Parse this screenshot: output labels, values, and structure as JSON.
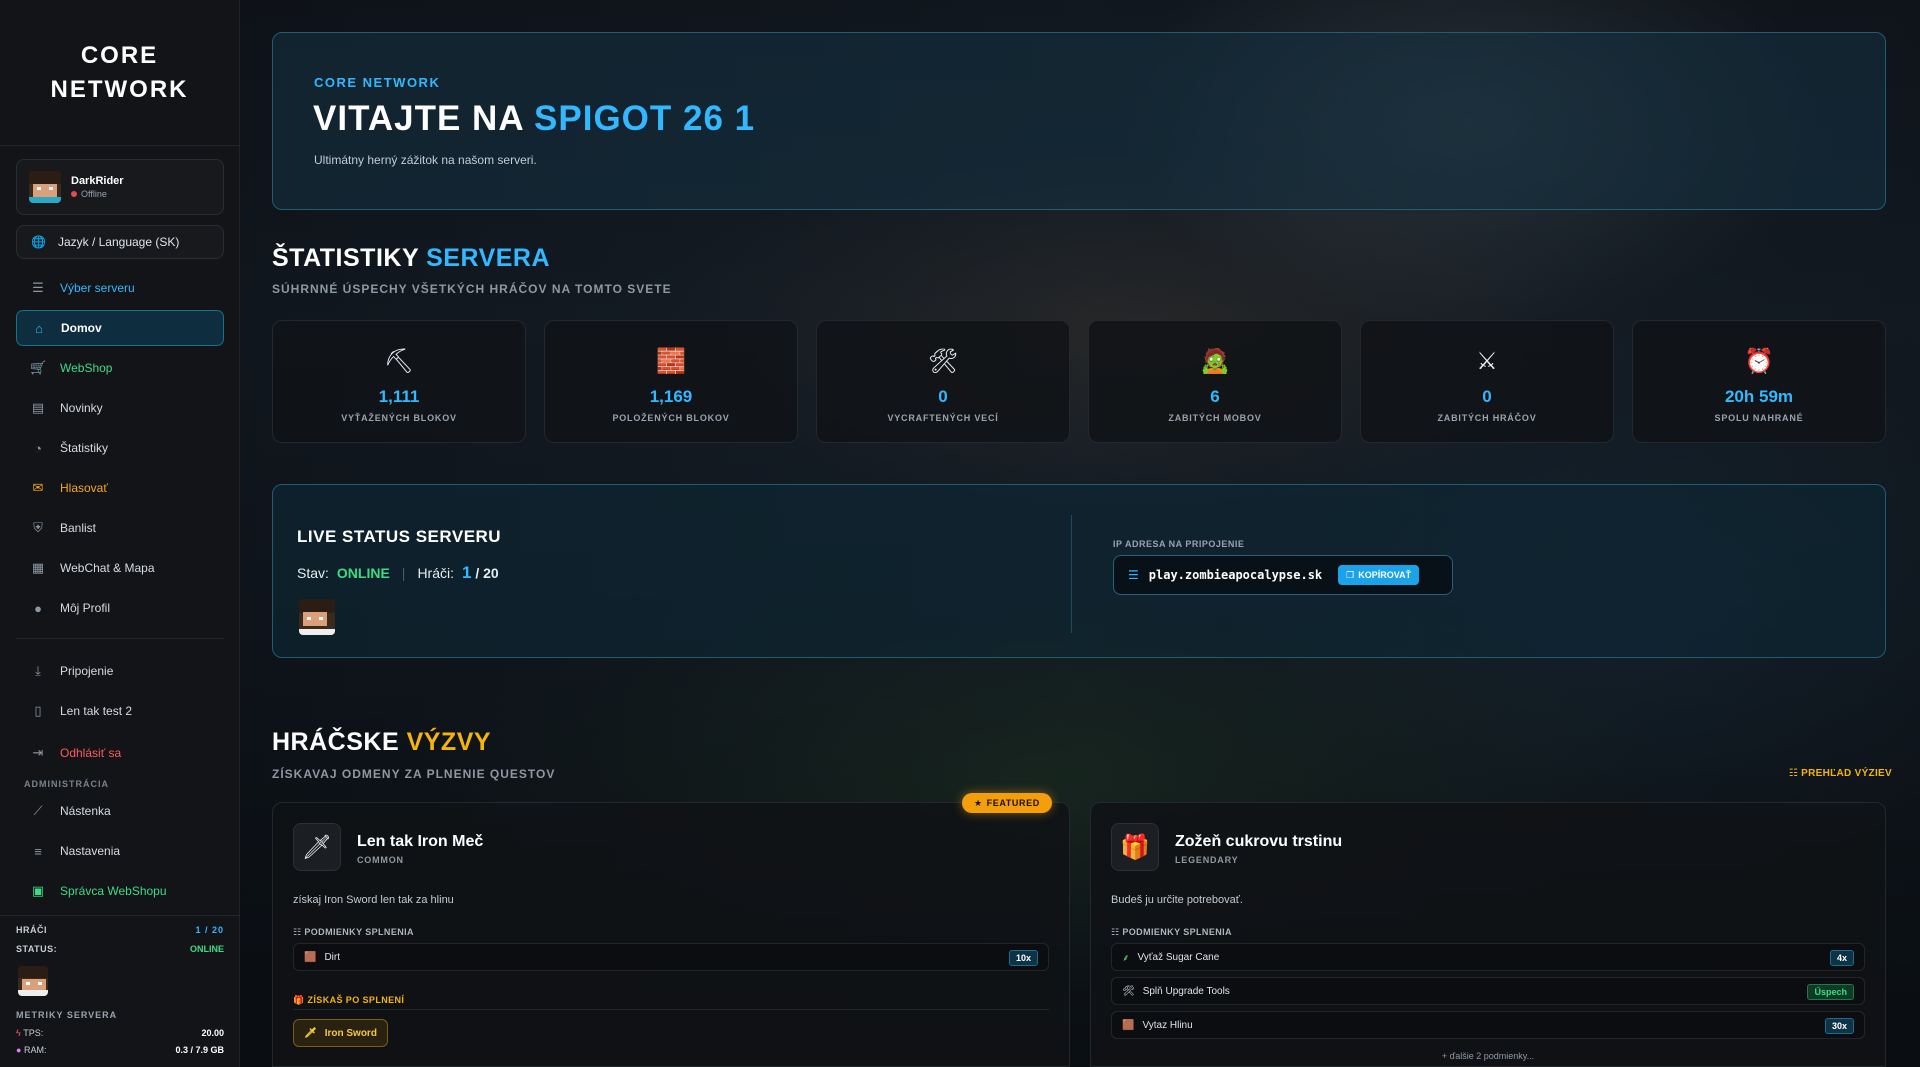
{
  "brand": {
    "line1": "CORE",
    "line2": "NETWORK"
  },
  "user": {
    "name": "DarkRider",
    "status": "Offline"
  },
  "language_button": "Jazyk / Language (SK)",
  "nav": {
    "server_select": "Výber serveru",
    "home": "Domov",
    "webshop": "WebShop",
    "news": "Novinky",
    "stats": "Štatistiky",
    "vote": "Hlasovať",
    "banlist": "Banlist",
    "webchat": "WebChat & Mapa",
    "profile": "Môj Profil",
    "connect": "Pripojenie",
    "test": "Len tak test 2",
    "logout": "Odhlásiť sa",
    "admin_section": "ADMINISTRÁCIA",
    "dashboard": "Nástenka",
    "settings": "Nastavenia",
    "shop_admin": "Správca WebShopu"
  },
  "sidebar_footer": {
    "players_label": "HRÁČI",
    "players_value": "1 / 20",
    "status_label": "STATUS:",
    "status_value": "ONLINE",
    "metrics_title": "METRIKY SERVERA",
    "tps_label": "TPS:",
    "tps_value": "20.00",
    "ram_label": "RAM:",
    "ram_value": "0.3 / 7.9 GB"
  },
  "hero": {
    "kicker": "CORE NETWORK",
    "title_prefix": "VITAJTE NA ",
    "title_accent": "SPIGOT 26 1",
    "subtitle": "Ultimátny herný zážitok na našom serveri."
  },
  "stats_section": {
    "title_prefix": "ŠTATISTIKY ",
    "title_accent": "SERVERA",
    "subtitle": "SÚHRNNÉ ÚSPECHY VŠETKÝCH HRÁČOV NA TOMTO SVETE",
    "items": [
      {
        "icon": "⛏",
        "value": "1,111",
        "label": "VYŤAŽENÝCH BLOKOV"
      },
      {
        "icon": "🧱",
        "value": "1,169",
        "label": "POLOŽENÝCH BLOKOV"
      },
      {
        "icon": "🛠",
        "value": "0",
        "label": "VYCRAFTENÝCH VECÍ"
      },
      {
        "icon": "🧟",
        "value": "6",
        "label": "ZABITÝCH MOBOV"
      },
      {
        "icon": "⚔",
        "value": "0",
        "label": "ZABITÝCH HRÁČOV"
      },
      {
        "icon": "⏰",
        "value": "20h 59m",
        "label": "SPOLU NAHRANÉ"
      }
    ]
  },
  "live": {
    "title": "LIVE STATUS SERVERU",
    "state_label": "Stav:",
    "state_value": "ONLINE",
    "players_label": "Hráči:",
    "players_online": "1",
    "players_max": "/ 20",
    "ip_label": "IP ADRESA NA PRIPOJENIE",
    "ip": "play.zombieapocalypse.sk",
    "copy_label": "KOPÍROVAŤ"
  },
  "quests_section": {
    "title_prefix": "HRÁČSKE ",
    "title_accent": "VÝZVY",
    "subtitle": "ZÍSKAVAJ ODMENY ZA PLNENIE QUESTOV",
    "overview_link": "☷ PREHĽAD VÝZIEV",
    "featured_badge": "FEATURED",
    "requirements_label": "☷ PODMIENKY SPLNENIA",
    "rewards_label": "🎁 ZÍSKAŠ PO SPLNENÍ",
    "quest1": {
      "name": "Len tak Iron Meč",
      "rarity": "COMMON",
      "description": "získaj Iron Sword len tak za hlinu",
      "req1_name": "Dirt",
      "req1_badge": "10x",
      "reward": "Iron Sword"
    },
    "quest2": {
      "name": "Zožeň cukrovu trstinu",
      "rarity": "LEGENDARY",
      "description": "Budeš ju určite potrebovať.",
      "req1_name": "Vyťaž Sugar Cane",
      "req1_badge": "4x",
      "req2_name": "Splň Upgrade Tools",
      "req2_badge": "Úspech",
      "req3_name": "Vytaz Hlinu",
      "req3_badge": "30x",
      "more": "+ ďalšie 2 podmienky..."
    }
  }
}
